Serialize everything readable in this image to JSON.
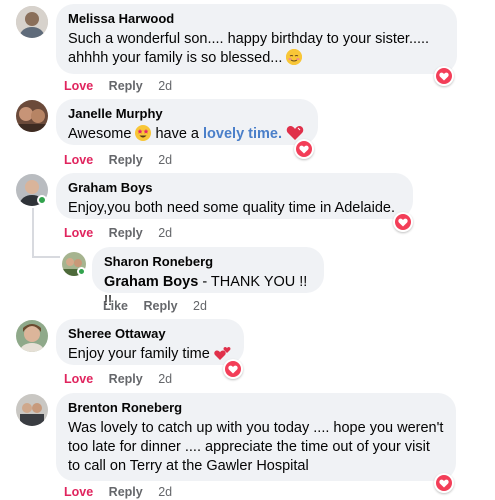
{
  "comments": [
    {
      "author": "Melissa Harwood",
      "text": "Such a wonderful son.... happy birthday to your sister..... ahhhh your family is so blessed...",
      "actions": {
        "love": "Love",
        "reply": "Reply",
        "time": "2d"
      }
    },
    {
      "author": "Janelle Murphy",
      "text_before": "Awesome ",
      "text_middle": " have a ",
      "highlight": "lovely time.",
      "actions": {
        "love": "Love",
        "reply": "Reply",
        "time": "2d"
      }
    },
    {
      "author": "Graham Boys",
      "text": "Enjoy,you both need some quality time in Adelaide.",
      "actions": {
        "love": "Love",
        "reply": "Reply",
        "time": "2d"
      }
    },
    {
      "author": "Sharon Roneberg",
      "mention": "Graham Boys",
      "text": " - THANK YOU !! !!",
      "actions": {
        "like": "Like",
        "reply": "Reply",
        "time": "2d"
      }
    },
    {
      "author": "Sheree Ottaway",
      "text": "Enjoy your family time",
      "actions": {
        "love": "Love",
        "reply": "Reply",
        "time": "2d"
      }
    },
    {
      "author": "Brenton Roneberg",
      "text": "Was lovely to catch up with you today .... hope you weren't too late for dinner .... appreciate the time out of your visit to call on Terry at the Gawler Hospital",
      "actions": {
        "love": "Love",
        "reply": "Reply",
        "time": "2d"
      }
    }
  ],
  "colors": {
    "bubble": "#f0f2f5",
    "love": "#e0245e",
    "meta": "#65676b",
    "highlight": "#4a7fc9",
    "online": "#31a24c",
    "heart_reaction": "#f33e58"
  }
}
